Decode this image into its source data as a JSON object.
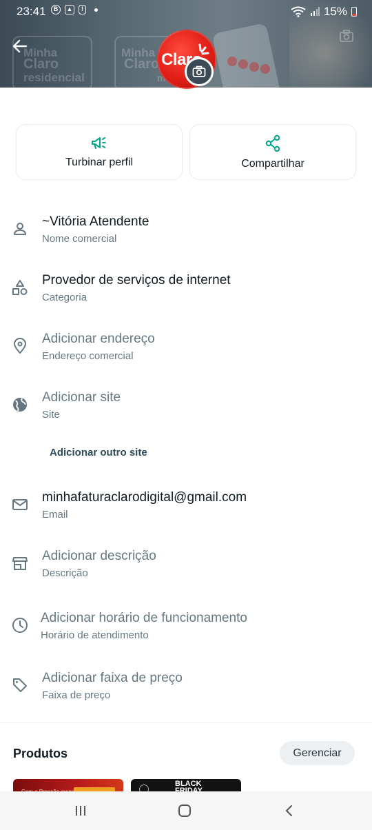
{
  "status_bar": {
    "time": "23:41",
    "battery": "15%",
    "icons": [
      "b-icon",
      "image-icon",
      "alert-icon",
      "wifi-icon",
      "signal-icon",
      "battery-icon"
    ]
  },
  "header": {
    "logo_text": "Claro",
    "background_texts": [
      "Minha",
      "Claro",
      "residencial",
      "Minha",
      "Claro",
      "móvel"
    ]
  },
  "actions": [
    {
      "label": "Turbinar perfil",
      "icon": "megaphone-icon"
    },
    {
      "label": "Compartilhar",
      "icon": "share-icon"
    }
  ],
  "fields": {
    "name": {
      "value": "~Vitória Atendente",
      "caption": "Nome comercial",
      "icon": "person-icon"
    },
    "category": {
      "value": "Provedor de serviços de internet",
      "caption": "Categoria",
      "icon": "shapes-icon"
    },
    "address": {
      "value": "Adicionar endereço",
      "caption": "Endereço comercial",
      "icon": "location-icon"
    },
    "site": {
      "value": "Adicionar site",
      "caption": "Site",
      "icon": "globe-icon"
    },
    "add_site_link": "Adicionar outro site",
    "email": {
      "value": "minhafaturaclarodigital@gmail.com",
      "caption": "Email",
      "icon": "mail-icon"
    },
    "description": {
      "value": "Adicionar descrição",
      "caption": "Descrição",
      "icon": "store-icon"
    },
    "hours": {
      "value": "Adicionar horário de funcionamento",
      "caption": "Horário de atendimento",
      "icon": "clock-icon"
    },
    "price": {
      "value": "Adicionar faixa de preço",
      "caption": "Faixa de preço",
      "icon": "tag-icon"
    }
  },
  "products": {
    "title": "Produtos",
    "manage_label": "Gerenciar",
    "thumb_texts": [
      "Com a Pressão mensal",
      "BLACK FRIDAY"
    ]
  },
  "colors": {
    "accent": "#00a884",
    "text_primary": "#111b21",
    "text_secondary": "#667781",
    "brand_red": "#e11f18"
  }
}
